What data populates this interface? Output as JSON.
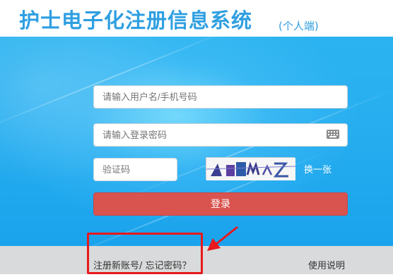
{
  "header": {
    "title": "护士电子化注册信息系统",
    "subtitle": "(个人端)"
  },
  "login_form": {
    "username_placeholder": "请输入用户名/手机号码",
    "password_placeholder": "请输入登录密码",
    "captcha_placeholder": "验证码",
    "captcha_text": "A M Z",
    "swap_captcha_label": "换一张",
    "login_button_label": "登录"
  },
  "footer": {
    "register_forgot_link": "注册新账号/ 忘记密码？",
    "help_link": "使用说明"
  },
  "colors": {
    "brand_blue": "#2f9fe1",
    "login_red": "#d9534f",
    "annotation_red": "#e8181c"
  },
  "icons": [
    "keyboard-icon"
  ]
}
